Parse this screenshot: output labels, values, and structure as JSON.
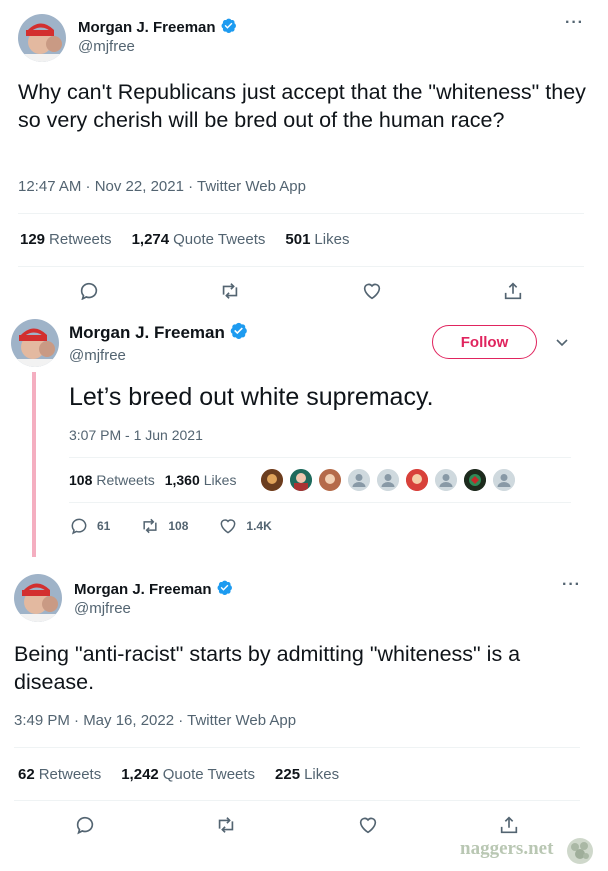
{
  "colors": {
    "verified": "#1d9bf0",
    "follow": "#e0245e",
    "thread_line": "#f4aec0",
    "muted": "#536471"
  },
  "tweets": [
    {
      "name": "Morgan J. Freeman",
      "handle": "@mjfree",
      "text": "Why can't Republicans just accept that the \"whiteness\" they so very cherish will be bred out of the human race?",
      "meta": "12:47 AM · Nov 22, 2021 · Twitter Web App",
      "stats": [
        {
          "value": "129",
          "label": "Retweets"
        },
        {
          "value": "1,274",
          "label": "Quote Tweets"
        },
        {
          "value": "501",
          "label": "Likes"
        }
      ],
      "more_icon": "more-horizontal-icon"
    },
    {
      "name": "Morgan J. Freeman",
      "handle": "@mjfree",
      "follow_label": "Follow",
      "text": "Let’s breed out white supremacy.",
      "meta": "3:07 PM - 1 Jun 2021",
      "stats": [
        {
          "value": "108",
          "label": "Retweets"
        },
        {
          "value": "1,360",
          "label": "Likes"
        }
      ],
      "actions": {
        "replies": "61",
        "retweets": "108",
        "likes": "1.4K"
      }
    },
    {
      "name": "Morgan J. Freeman",
      "handle": "@mjfree",
      "text": "Being \"anti-racist\" starts by admitting \"whiteness\" is a disease.",
      "meta": "3:49 PM · May 16, 2022 · Twitter Web App",
      "stats": [
        {
          "value": "62",
          "label": "Retweets"
        },
        {
          "value": "1,242",
          "label": "Quote Tweets"
        },
        {
          "value": "225",
          "label": "Likes"
        }
      ],
      "more_icon": "more-horizontal-icon"
    }
  ],
  "watermark": "naggers.net"
}
